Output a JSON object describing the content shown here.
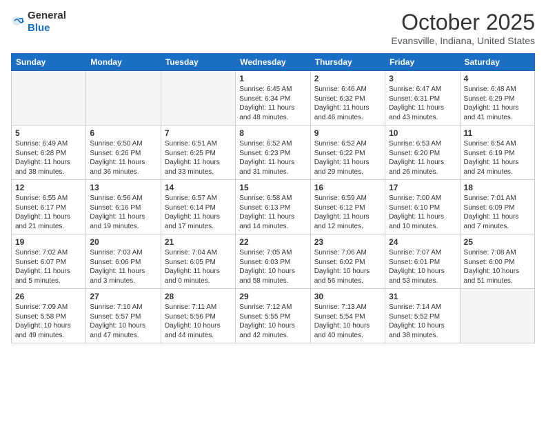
{
  "header": {
    "logo_general": "General",
    "logo_blue": "Blue",
    "month": "October 2025",
    "location": "Evansville, Indiana, United States"
  },
  "days": [
    "Sunday",
    "Monday",
    "Tuesday",
    "Wednesday",
    "Thursday",
    "Friday",
    "Saturday"
  ],
  "weeks": [
    [
      {
        "day": "",
        "text": "",
        "empty": true
      },
      {
        "day": "",
        "text": "",
        "empty": true
      },
      {
        "day": "",
        "text": "",
        "empty": true
      },
      {
        "day": "1",
        "text": "Sunrise: 6:45 AM\nSunset: 6:34 PM\nDaylight: 11 hours and 48 minutes.",
        "empty": false
      },
      {
        "day": "2",
        "text": "Sunrise: 6:46 AM\nSunset: 6:32 PM\nDaylight: 11 hours and 46 minutes.",
        "empty": false
      },
      {
        "day": "3",
        "text": "Sunrise: 6:47 AM\nSunset: 6:31 PM\nDaylight: 11 hours and 43 minutes.",
        "empty": false
      },
      {
        "day": "4",
        "text": "Sunrise: 6:48 AM\nSunset: 6:29 PM\nDaylight: 11 hours and 41 minutes.",
        "empty": false
      }
    ],
    [
      {
        "day": "5",
        "text": "Sunrise: 6:49 AM\nSunset: 6:28 PM\nDaylight: 11 hours and 38 minutes.",
        "empty": false
      },
      {
        "day": "6",
        "text": "Sunrise: 6:50 AM\nSunset: 6:26 PM\nDaylight: 11 hours and 36 minutes.",
        "empty": false
      },
      {
        "day": "7",
        "text": "Sunrise: 6:51 AM\nSunset: 6:25 PM\nDaylight: 11 hours and 33 minutes.",
        "empty": false
      },
      {
        "day": "8",
        "text": "Sunrise: 6:52 AM\nSunset: 6:23 PM\nDaylight: 11 hours and 31 minutes.",
        "empty": false
      },
      {
        "day": "9",
        "text": "Sunrise: 6:52 AM\nSunset: 6:22 PM\nDaylight: 11 hours and 29 minutes.",
        "empty": false
      },
      {
        "day": "10",
        "text": "Sunrise: 6:53 AM\nSunset: 6:20 PM\nDaylight: 11 hours and 26 minutes.",
        "empty": false
      },
      {
        "day": "11",
        "text": "Sunrise: 6:54 AM\nSunset: 6:19 PM\nDaylight: 11 hours and 24 minutes.",
        "empty": false
      }
    ],
    [
      {
        "day": "12",
        "text": "Sunrise: 6:55 AM\nSunset: 6:17 PM\nDaylight: 11 hours and 21 minutes.",
        "empty": false
      },
      {
        "day": "13",
        "text": "Sunrise: 6:56 AM\nSunset: 6:16 PM\nDaylight: 11 hours and 19 minutes.",
        "empty": false
      },
      {
        "day": "14",
        "text": "Sunrise: 6:57 AM\nSunset: 6:14 PM\nDaylight: 11 hours and 17 minutes.",
        "empty": false
      },
      {
        "day": "15",
        "text": "Sunrise: 6:58 AM\nSunset: 6:13 PM\nDaylight: 11 hours and 14 minutes.",
        "empty": false
      },
      {
        "day": "16",
        "text": "Sunrise: 6:59 AM\nSunset: 6:12 PM\nDaylight: 11 hours and 12 minutes.",
        "empty": false
      },
      {
        "day": "17",
        "text": "Sunrise: 7:00 AM\nSunset: 6:10 PM\nDaylight: 11 hours and 10 minutes.",
        "empty": false
      },
      {
        "day": "18",
        "text": "Sunrise: 7:01 AM\nSunset: 6:09 PM\nDaylight: 11 hours and 7 minutes.",
        "empty": false
      }
    ],
    [
      {
        "day": "19",
        "text": "Sunrise: 7:02 AM\nSunset: 6:07 PM\nDaylight: 11 hours and 5 minutes.",
        "empty": false
      },
      {
        "day": "20",
        "text": "Sunrise: 7:03 AM\nSunset: 6:06 PM\nDaylight: 11 hours and 3 minutes.",
        "empty": false
      },
      {
        "day": "21",
        "text": "Sunrise: 7:04 AM\nSunset: 6:05 PM\nDaylight: 11 hours and 0 minutes.",
        "empty": false
      },
      {
        "day": "22",
        "text": "Sunrise: 7:05 AM\nSunset: 6:03 PM\nDaylight: 10 hours and 58 minutes.",
        "empty": false
      },
      {
        "day": "23",
        "text": "Sunrise: 7:06 AM\nSunset: 6:02 PM\nDaylight: 10 hours and 56 minutes.",
        "empty": false
      },
      {
        "day": "24",
        "text": "Sunrise: 7:07 AM\nSunset: 6:01 PM\nDaylight: 10 hours and 53 minutes.",
        "empty": false
      },
      {
        "day": "25",
        "text": "Sunrise: 7:08 AM\nSunset: 6:00 PM\nDaylight: 10 hours and 51 minutes.",
        "empty": false
      }
    ],
    [
      {
        "day": "26",
        "text": "Sunrise: 7:09 AM\nSunset: 5:58 PM\nDaylight: 10 hours and 49 minutes.",
        "empty": false
      },
      {
        "day": "27",
        "text": "Sunrise: 7:10 AM\nSunset: 5:57 PM\nDaylight: 10 hours and 47 minutes.",
        "empty": false
      },
      {
        "day": "28",
        "text": "Sunrise: 7:11 AM\nSunset: 5:56 PM\nDaylight: 10 hours and 44 minutes.",
        "empty": false
      },
      {
        "day": "29",
        "text": "Sunrise: 7:12 AM\nSunset: 5:55 PM\nDaylight: 10 hours and 42 minutes.",
        "empty": false
      },
      {
        "day": "30",
        "text": "Sunrise: 7:13 AM\nSunset: 5:54 PM\nDaylight: 10 hours and 40 minutes.",
        "empty": false
      },
      {
        "day": "31",
        "text": "Sunrise: 7:14 AM\nSunset: 5:52 PM\nDaylight: 10 hours and 38 minutes.",
        "empty": false
      },
      {
        "day": "",
        "text": "",
        "empty": true
      }
    ]
  ]
}
